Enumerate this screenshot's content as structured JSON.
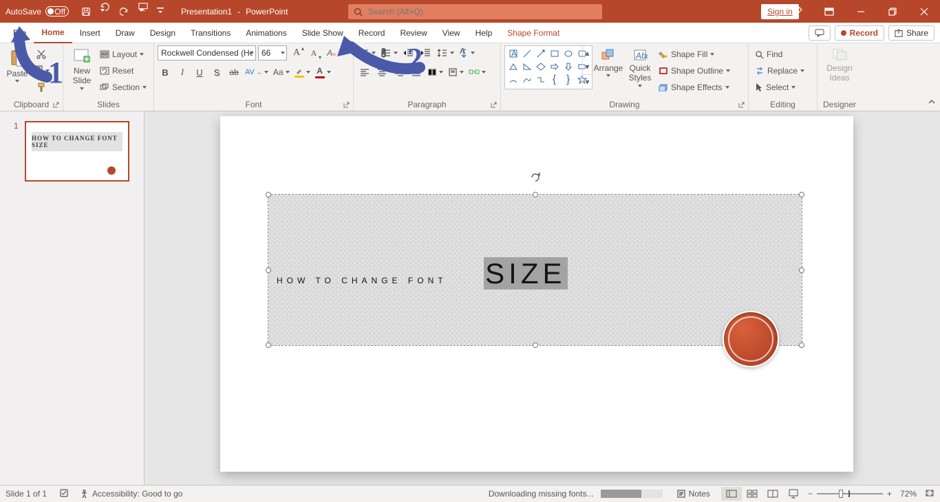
{
  "titlebar": {
    "autosave_label": "AutoSave",
    "autosave_state": "Off",
    "title_doc": "Presentation1",
    "title_app": "PowerPoint",
    "search_placeholder": "Search (Alt+Q)",
    "signin": "Sign in"
  },
  "tabs": {
    "items": [
      "File",
      "Home",
      "Insert",
      "Draw",
      "Design",
      "Transitions",
      "Animations",
      "Slide Show",
      "Record",
      "Review",
      "View",
      "Help",
      "Shape Format"
    ],
    "active": "Home",
    "comments_btn": "",
    "record_btn": "Record",
    "share_btn": "Share"
  },
  "ribbon": {
    "clipboard": {
      "paste": "Paste",
      "group_label": "Clipboard"
    },
    "slides": {
      "new_slide": "New Slide",
      "layout": "Layout",
      "reset": "Reset",
      "section": "Section",
      "group_label": "Slides"
    },
    "font": {
      "name": "Rockwell Condensed (Hea",
      "size": "66",
      "group_label": "Font"
    },
    "paragraph": {
      "group_label": "Paragraph"
    },
    "drawing": {
      "arrange": "Arrange",
      "quick_styles": "Quick Styles",
      "shape_fill": "Shape Fill",
      "shape_outline": "Shape Outline",
      "shape_effects": "Shape Effects",
      "group_label": "Drawing"
    },
    "editing": {
      "find": "Find",
      "replace": "Replace",
      "select": "Select",
      "group_label": "Editing"
    },
    "designer": {
      "design_ideas": "Design Ideas",
      "group_label": "Designer"
    }
  },
  "thumb": {
    "num": "1",
    "text": "HOW TO CHANGE FONT SIZE"
  },
  "slide": {
    "text_main": "HOW TO CHANGE FONT",
    "text_sel": "SIZE"
  },
  "status": {
    "slide_indicator": "Slide 1 of 1",
    "accessibility": "Accessibility: Good to go",
    "download": "Downloading missing fonts...",
    "notes": "Notes",
    "zoom": "72%"
  },
  "annotations": {
    "one": "1",
    "two": "2"
  }
}
